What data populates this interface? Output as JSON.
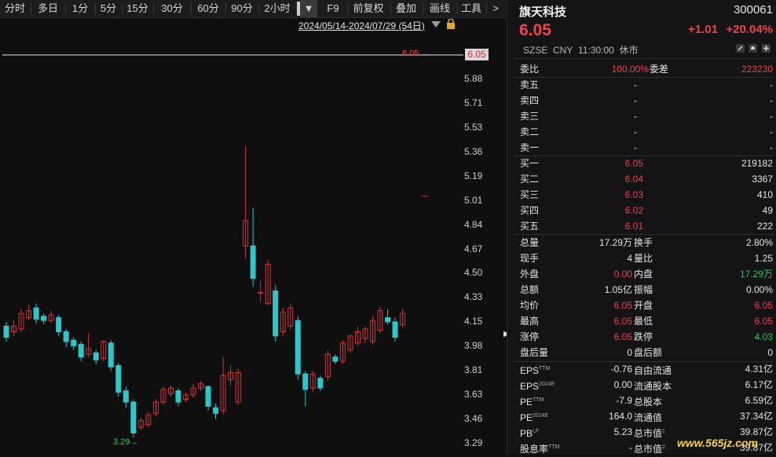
{
  "toolbar": {
    "items": [
      "分时",
      "多日",
      "1分",
      "5分",
      "15分",
      "30分",
      "60分",
      "90分",
      "2小时",
      "▼",
      "F9",
      "前复权",
      "叠加",
      "画线",
      "工具",
      ">"
    ]
  },
  "date_range": "2024/05/14-2024/07/29 (54日)",
  "chart": {
    "price_labels": [
      "5.88",
      "5.71",
      "5.53",
      "5.36",
      "5.19",
      "5.01",
      "4.84",
      "4.67",
      "4.50",
      "4.33",
      "4.15",
      "3.98",
      "3.81",
      "3.63",
      "3.46",
      "3.29"
    ],
    "current_price_tag": "6.05",
    "current_price_marker": "6.05 →",
    "low_marker": "3.29→",
    "colors": {
      "up": "#d8313b",
      "down": "#2ec7c9",
      "line": "#bdbdbd"
    }
  },
  "stock": {
    "name": "旗天科技",
    "code": "300061",
    "price": "6.05",
    "change": "+1.01",
    "change_pct": "+20.04%",
    "exchange": "SZSE",
    "currency": "CNY",
    "time": "11:30:00",
    "status": "休市"
  },
  "order_ratio": {
    "label1": "委比",
    "value1": "100.00%",
    "label2": "委差",
    "value2": "223230"
  },
  "asks": [
    {
      "label": "卖五",
      "price": "-",
      "vol": "-"
    },
    {
      "label": "卖四",
      "price": "-",
      "vol": "-"
    },
    {
      "label": "卖三",
      "price": "-",
      "vol": "-"
    },
    {
      "label": "卖二",
      "price": "-",
      "vol": "-"
    },
    {
      "label": "卖一",
      "price": "-",
      "vol": "-"
    }
  ],
  "bids": [
    {
      "label": "买一",
      "price": "6.05",
      "vol": "219182"
    },
    {
      "label": "买二",
      "price": "6.04",
      "vol": "3367"
    },
    {
      "label": "买三",
      "price": "6.03",
      "vol": "410"
    },
    {
      "label": "买四",
      "price": "6.02",
      "vol": "49"
    },
    {
      "label": "买五",
      "price": "6.01",
      "vol": "222"
    }
  ],
  "stats": [
    {
      "l1": "总量",
      "v1": "17.29万",
      "c1": "white",
      "l2": "换手",
      "v2": "2.80%",
      "c2": "white"
    },
    {
      "l1": "现手",
      "v1": "4",
      "c1": "white",
      "l2": "量比",
      "v2": "1.25",
      "c2": "white"
    },
    {
      "l1": "外盘",
      "v1": "0.00",
      "c1": "red",
      "l2": "内盘",
      "v2": "17.29万",
      "c2": "green"
    },
    {
      "l1": "总额",
      "v1": "1.05亿",
      "c1": "white",
      "l2": "振幅",
      "v2": "0.00%",
      "c2": "white"
    },
    {
      "l1": "均价",
      "v1": "6.05",
      "c1": "red",
      "l2": "开盘",
      "v2": "6.05",
      "c2": "red"
    },
    {
      "l1": "最高",
      "v1": "6.05",
      "c1": "red",
      "l2": "最低",
      "v2": "6.05",
      "c2": "red"
    },
    {
      "l1": "涨停",
      "v1": "6.05",
      "c1": "red",
      "l2": "跌停",
      "v2": "4.03",
      "c2": "green"
    },
    {
      "l1": "盘后量",
      "v1": "0",
      "c1": "white",
      "l2": "盘后额",
      "v2": "0",
      "c2": "white"
    }
  ],
  "fundamentals": [
    {
      "l1": "EPS",
      "s1": "TTM",
      "v1": "-0.76",
      "l2": "自由流通",
      "s2": "",
      "v2": "4.31亿"
    },
    {
      "l1": "EPS",
      "s1": "2024E",
      "v1": "0.00",
      "l2": "流通股本",
      "s2": "",
      "v2": "6.17亿"
    },
    {
      "l1": "PE",
      "s1": "TTM",
      "v1": "-7.9",
      "l2": "总股本",
      "s2": "",
      "v2": "6.59亿"
    },
    {
      "l1": "PE",
      "s1": "2024E",
      "v1": "164.0",
      "l2": "流通值",
      "s2": "",
      "v2": "37.34亿"
    },
    {
      "l1": "PB",
      "s1": "LF",
      "v1": "5.23",
      "l2": "总市值",
      "s2": "1",
      "v2": "39.87亿"
    },
    {
      "l1": "股息率",
      "s1": "TTM",
      "v1": "-",
      "l2": "总市值",
      "s2": "2",
      "v2": "39.87亿"
    }
  ],
  "watermark": "www.565jz.com",
  "candles": [
    {
      "o": 4.12,
      "c": 4.04,
      "h": 4.15,
      "l": 4.01
    },
    {
      "o": 4.08,
      "c": 4.12,
      "h": 4.16,
      "l": 4.05
    },
    {
      "o": 4.1,
      "c": 4.21,
      "h": 4.24,
      "l": 4.08
    },
    {
      "o": 4.18,
      "c": 4.23,
      "h": 4.27,
      "l": 4.16
    },
    {
      "o": 4.25,
      "c": 4.17,
      "h": 4.28,
      "l": 4.14
    },
    {
      "o": 4.19,
      "c": 4.16,
      "h": 4.21,
      "l": 4.13
    },
    {
      "o": 4.16,
      "c": 4.2,
      "h": 4.23,
      "l": 4.14
    },
    {
      "o": 4.18,
      "c": 4.08,
      "h": 4.2,
      "l": 4.05
    },
    {
      "o": 4.08,
      "c": 4.01,
      "h": 4.1,
      "l": 3.97
    },
    {
      "o": 4.02,
      "c": 3.98,
      "h": 4.04,
      "l": 3.95
    },
    {
      "o": 3.99,
      "c": 3.9,
      "h": 4.01,
      "l": 3.87
    },
    {
      "o": 3.92,
      "c": 3.96,
      "h": 4.07,
      "l": 3.9
    },
    {
      "o": 3.93,
      "c": 3.88,
      "h": 3.95,
      "l": 3.85
    },
    {
      "o": 3.89,
      "c": 4.01,
      "h": 4.02,
      "l": 3.87
    },
    {
      "o": 4.0,
      "c": 3.83,
      "h": 4.02,
      "l": 3.8
    },
    {
      "o": 3.84,
      "c": 3.65,
      "h": 3.86,
      "l": 3.62
    },
    {
      "o": 3.66,
      "c": 3.58,
      "h": 3.69,
      "l": 3.54
    },
    {
      "o": 3.58,
      "c": 3.36,
      "h": 3.6,
      "l": 3.33
    },
    {
      "o": 3.4,
      "c": 3.45,
      "h": 3.47,
      "l": 3.38
    },
    {
      "o": 3.42,
      "c": 3.49,
      "h": 3.51,
      "l": 3.4
    },
    {
      "o": 3.5,
      "c": 3.58,
      "h": 3.6,
      "l": 3.48
    },
    {
      "o": 3.58,
      "c": 3.67,
      "h": 3.69,
      "l": 3.56
    },
    {
      "o": 3.64,
      "c": 3.68,
      "h": 3.7,
      "l": 3.62
    },
    {
      "o": 3.66,
      "c": 3.58,
      "h": 3.68,
      "l": 3.55
    },
    {
      "o": 3.6,
      "c": 3.63,
      "h": 3.65,
      "l": 3.58
    },
    {
      "o": 3.63,
      "c": 3.68,
      "h": 3.71,
      "l": 3.61
    },
    {
      "o": 3.68,
      "c": 3.71,
      "h": 3.73,
      "l": 3.66
    },
    {
      "o": 3.69,
      "c": 3.55,
      "h": 3.7,
      "l": 3.52
    },
    {
      "o": 3.54,
      "c": 3.5,
      "h": 3.57,
      "l": 3.46
    },
    {
      "o": 3.52,
      "c": 3.77,
      "h": 3.9,
      "l": 3.49
    },
    {
      "o": 3.74,
      "c": 3.79,
      "h": 3.84,
      "l": 3.7
    },
    {
      "o": 3.58,
      "c": 3.79,
      "h": 3.82,
      "l": 3.56
    },
    {
      "o": 4.69,
      "c": 4.87,
      "h": 5.4,
      "l": 4.6
    },
    {
      "o": 4.69,
      "c": 4.46,
      "h": 4.96,
      "l": 4.4
    },
    {
      "o": 4.36,
      "c": 4.36,
      "h": 4.44,
      "l": 4.29
    },
    {
      "o": 4.28,
      "c": 4.56,
      "h": 4.59,
      "l": 4.27
    },
    {
      "o": 4.37,
      "c": 4.05,
      "h": 4.41,
      "l": 4.01
    },
    {
      "o": 4.08,
      "c": 4.22,
      "h": 4.25,
      "l": 4.05
    },
    {
      "o": 4.12,
      "c": 4.25,
      "h": 4.28,
      "l": 4.09
    },
    {
      "o": 4.16,
      "c": 3.78,
      "h": 4.19,
      "l": 3.74
    },
    {
      "o": 3.78,
      "c": 3.67,
      "h": 3.8,
      "l": 3.55
    },
    {
      "o": 3.68,
      "c": 3.78,
      "h": 3.8,
      "l": 3.65
    },
    {
      "o": 3.75,
      "c": 3.68,
      "h": 3.77,
      "l": 3.66
    },
    {
      "o": 3.76,
      "c": 3.92,
      "h": 3.95,
      "l": 3.73
    },
    {
      "o": 3.9,
      "c": 3.87,
      "h": 3.92,
      "l": 3.85
    },
    {
      "o": 3.87,
      "c": 4.0,
      "h": 4.02,
      "l": 3.85
    },
    {
      "o": 3.95,
      "c": 4.05,
      "h": 4.06,
      "l": 3.93
    },
    {
      "o": 4.0,
      "c": 4.08,
      "h": 4.12,
      "l": 3.98
    },
    {
      "o": 4.03,
      "c": 4.1,
      "h": 4.12,
      "l": 4.0
    },
    {
      "o": 4.01,
      "c": 4.16,
      "h": 4.19,
      "l": 3.99
    },
    {
      "o": 4.09,
      "c": 4.23,
      "h": 4.26,
      "l": 4.07
    },
    {
      "o": 4.18,
      "c": 4.15,
      "h": 4.24,
      "l": 4.13
    },
    {
      "o": 4.15,
      "c": 4.04,
      "h": 4.18,
      "l": 4.01
    },
    {
      "o": 4.13,
      "c": 4.21,
      "h": 4.24,
      "l": 4.11
    }
  ]
}
